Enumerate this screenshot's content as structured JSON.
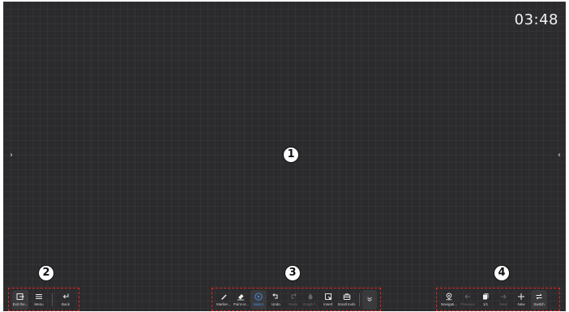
{
  "clock": "03:48",
  "edge": {
    "left": "›",
    "right": "‹"
  },
  "badges": [
    "1",
    "2",
    "3",
    "4"
  ],
  "left_toolbar": [
    {
      "label": "Exit the...",
      "icon": "exit-icon"
    },
    {
      "label": "Menu",
      "icon": "menu-icon"
    },
    {
      "label": "Back",
      "icon": "back-icon"
    }
  ],
  "center_toolbar": [
    {
      "label": "Marker...",
      "icon": "marker-icon"
    },
    {
      "label": "Point er...",
      "icon": "eraser-icon"
    },
    {
      "label": "Select",
      "icon": "select-icon",
      "state": "active"
    },
    {
      "label": "Undo",
      "icon": "undo-icon"
    },
    {
      "label": "Redo",
      "icon": "redo-icon",
      "state": "disabled"
    },
    {
      "label": "Graph f...",
      "icon": "graph-icon",
      "state": "disabled"
    },
    {
      "label": "Insert",
      "icon": "insert-icon"
    },
    {
      "label": "Small tools",
      "icon": "toolbox-icon"
    },
    {
      "label": "",
      "icon": "chevron-down-icon"
    }
  ],
  "right_toolbar": [
    {
      "label": "Navigati...",
      "icon": "navigation-icon"
    },
    {
      "label": "Previous",
      "icon": "arrow-left-icon",
      "state": "disabled"
    },
    {
      "label": "1/1",
      "icon": "pages-icon"
    },
    {
      "label": "Next",
      "icon": "arrow-right-icon",
      "state": "disabled"
    },
    {
      "label": "New",
      "icon": "plus-icon"
    },
    {
      "label": "Switch",
      "icon": "switch-icon"
    }
  ],
  "colors": {
    "canvas": "#2b2b2d",
    "annotation": "#e02424",
    "active": "#4a8fe7"
  }
}
